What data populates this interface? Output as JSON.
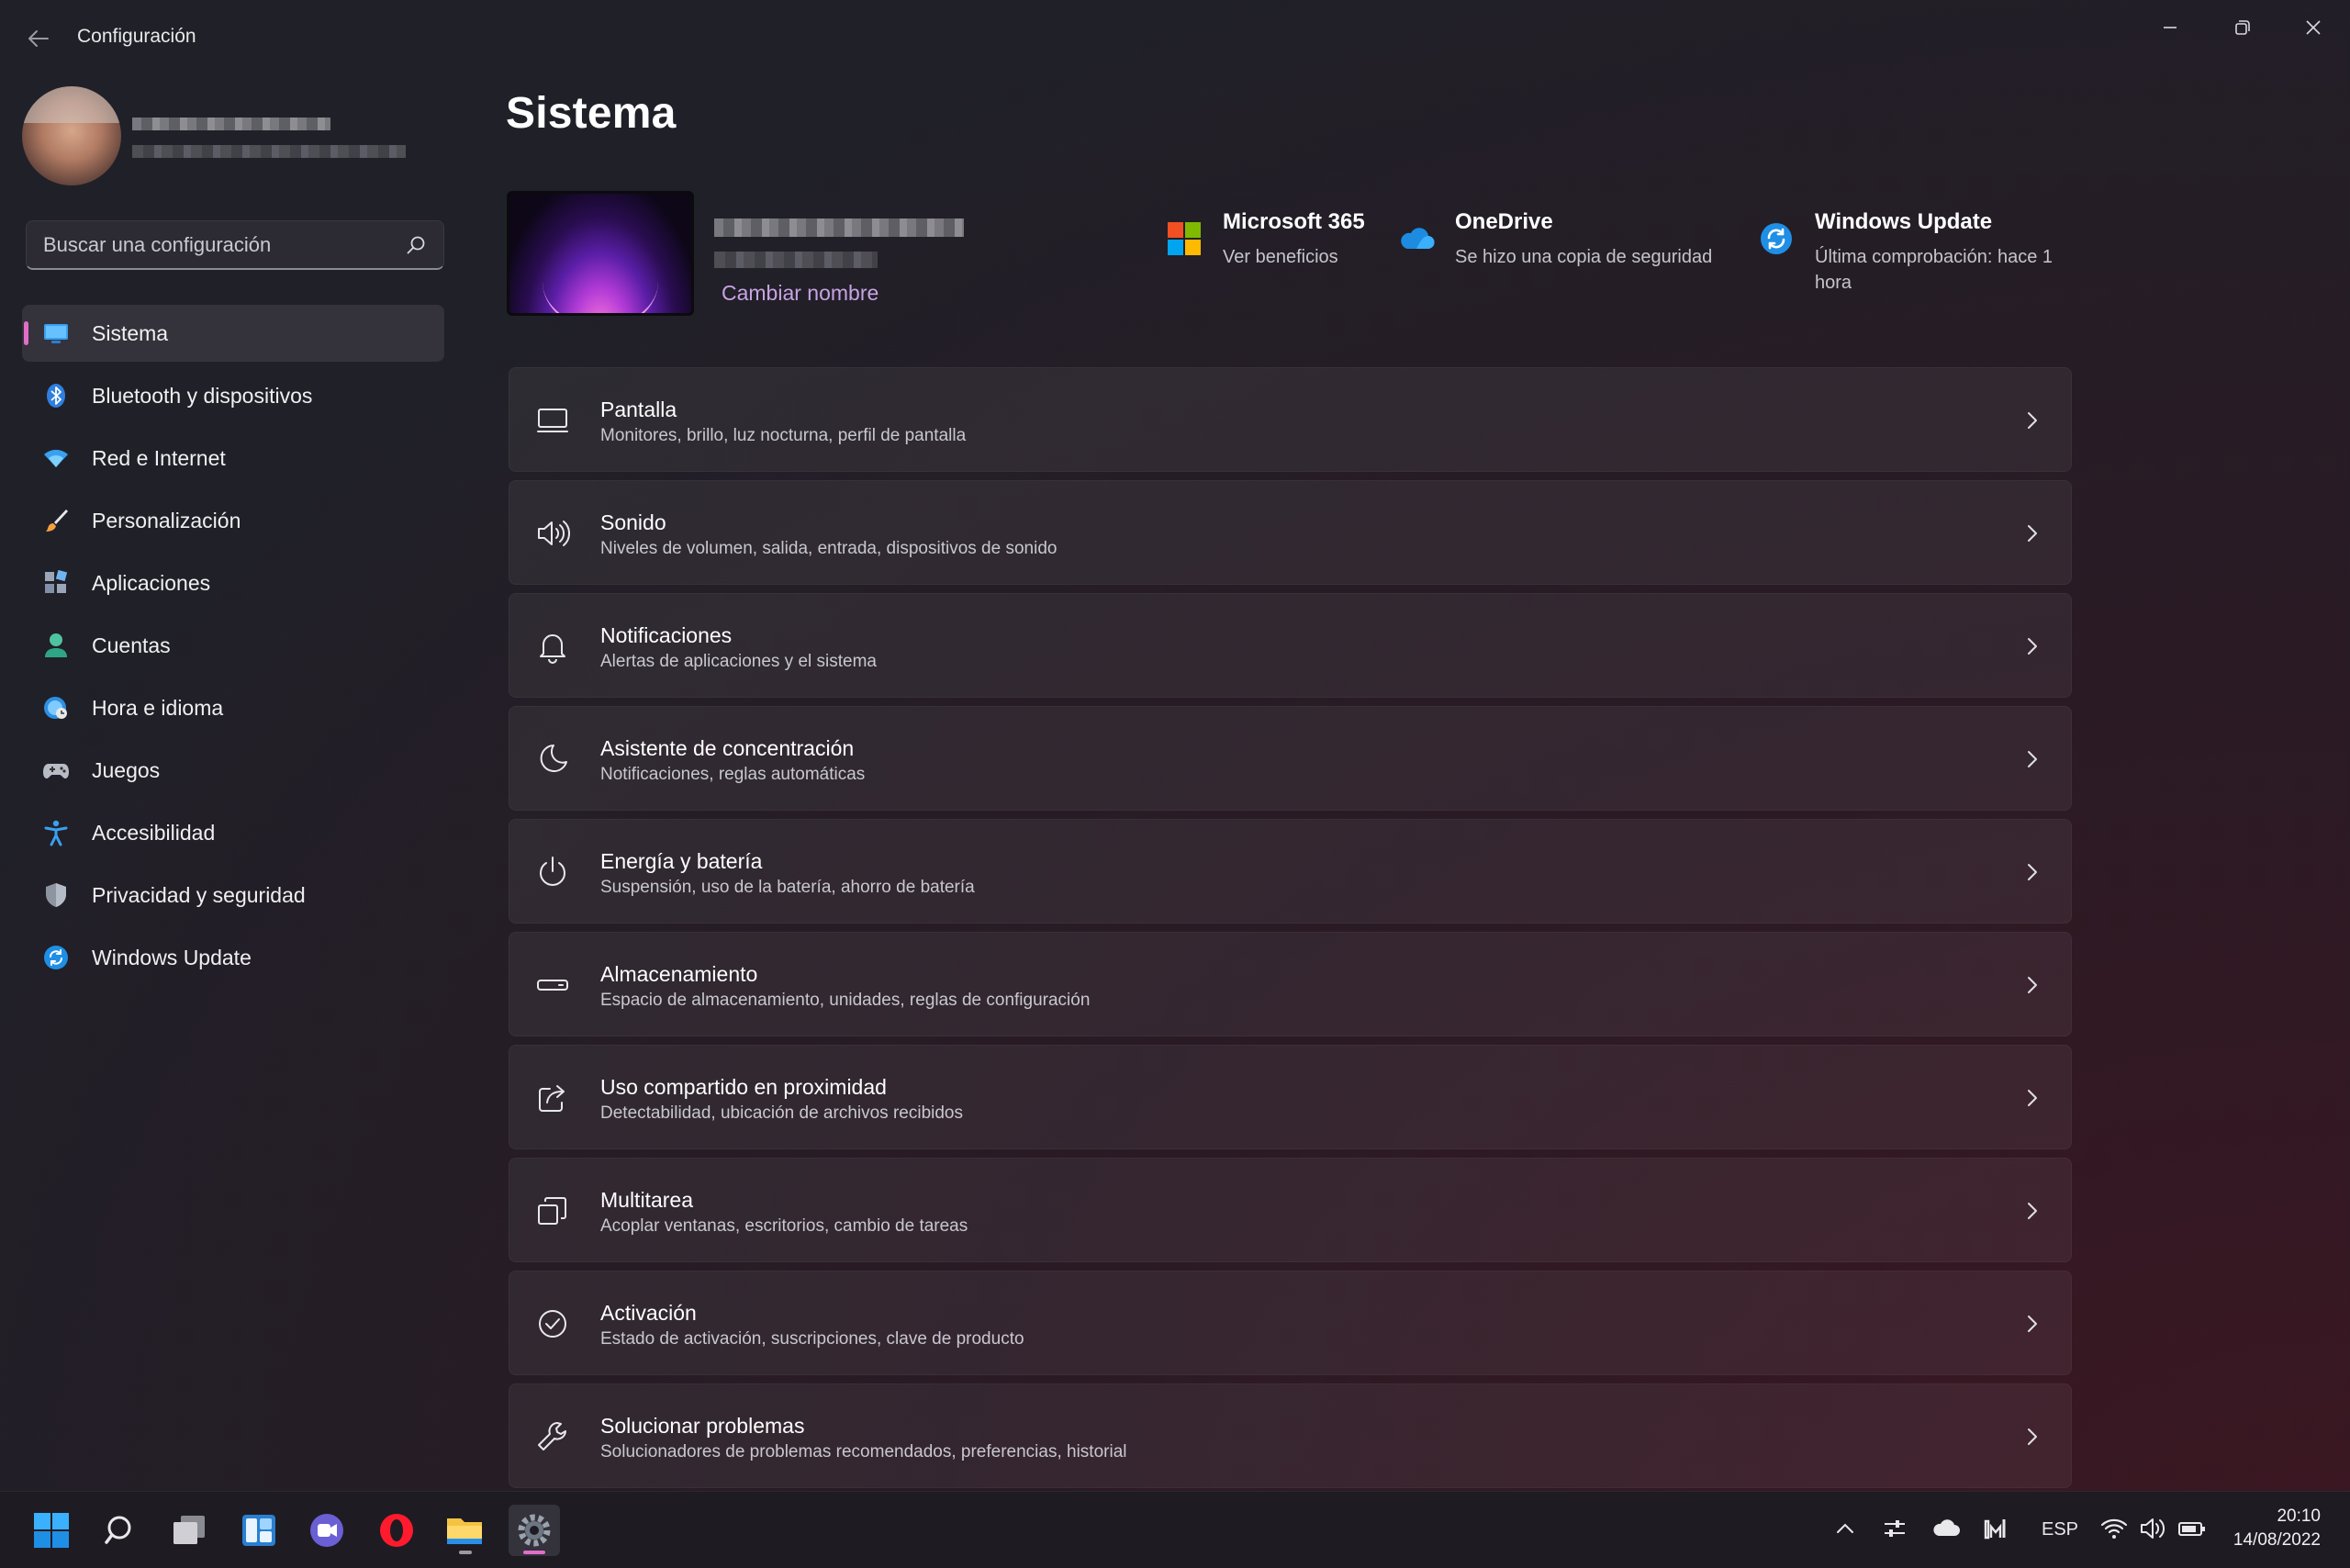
{
  "window": {
    "title": "Configuración",
    "controls": [
      "minimize-icon",
      "restore-icon",
      "close-icon"
    ]
  },
  "sidebar": {
    "search_placeholder": "Buscar una configuración",
    "items": [
      {
        "label": "Sistema",
        "icon": "monitor-icon",
        "active": true
      },
      {
        "label": "Bluetooth y dispositivos",
        "icon": "bluetooth-icon"
      },
      {
        "label": "Red e Internet",
        "icon": "wifi-icon"
      },
      {
        "label": "Personalización",
        "icon": "brush-icon"
      },
      {
        "label": "Aplicaciones",
        "icon": "apps-icon"
      },
      {
        "label": "Cuentas",
        "icon": "person-icon"
      },
      {
        "label": "Hora e idioma",
        "icon": "globe-clock-icon"
      },
      {
        "label": "Juegos",
        "icon": "gamepad-icon"
      },
      {
        "label": "Accesibilidad",
        "icon": "accessibility-icon"
      },
      {
        "label": "Privacidad y seguridad",
        "icon": "shield-icon"
      },
      {
        "label": "Windows Update",
        "icon": "update-icon"
      }
    ]
  },
  "main": {
    "title": "Sistema",
    "rename_label": "Cambiar nombre",
    "quick": [
      {
        "title": "Microsoft 365",
        "subtitle": "Ver beneficios",
        "icon": "microsoft-logo-icon"
      },
      {
        "title": "OneDrive",
        "subtitle": "Se hizo una copia de seguridad",
        "icon": "cloud-icon"
      },
      {
        "title": "Windows Update",
        "subtitle": "Última comprobación: hace 1 hora",
        "icon": "update-icon"
      }
    ],
    "cards": [
      {
        "title": "Pantalla",
        "subtitle": "Monitores, brillo, luz nocturna, perfil de pantalla",
        "icon": "display-icon"
      },
      {
        "title": "Sonido",
        "subtitle": "Niveles de volumen, salida, entrada, dispositivos de sonido",
        "icon": "speaker-icon"
      },
      {
        "title": "Notificaciones",
        "subtitle": "Alertas de aplicaciones y el sistema",
        "icon": "bell-icon"
      },
      {
        "title": "Asistente de concentración",
        "subtitle": "Notificaciones, reglas automáticas",
        "icon": "moon-icon"
      },
      {
        "title": "Energía y batería",
        "subtitle": "Suspensión, uso de la batería, ahorro de batería",
        "icon": "power-icon"
      },
      {
        "title": "Almacenamiento",
        "subtitle": "Espacio de almacenamiento, unidades, reglas de configuración",
        "icon": "storage-icon"
      },
      {
        "title": "Uso compartido en proximidad",
        "subtitle": "Detectabilidad, ubicación de archivos recibidos",
        "icon": "share-icon"
      },
      {
        "title": "Multitarea",
        "subtitle": "Acoplar ventanas, escritorios, cambio de tareas",
        "icon": "multitask-icon"
      },
      {
        "title": "Activación",
        "subtitle": "Estado de activación, suscripciones, clave de producto",
        "icon": "check-circle-icon"
      },
      {
        "title": "Solucionar problemas",
        "subtitle": "Solucionadores de problemas recomendados, preferencias, historial",
        "icon": "wrench-icon"
      }
    ]
  },
  "taskbar": {
    "apps": [
      "start-icon",
      "search-icon",
      "task-view-icon",
      "widgets-icon",
      "chat-icon",
      "opera-icon",
      "file-explorer-icon",
      "settings-icon"
    ],
    "tray": {
      "language": "ESP",
      "time": "20:10",
      "date": "14/08/2022"
    }
  },
  "colors": {
    "accent": "#e06ec8",
    "link": "#c7a4e3",
    "background": "#222027"
  }
}
